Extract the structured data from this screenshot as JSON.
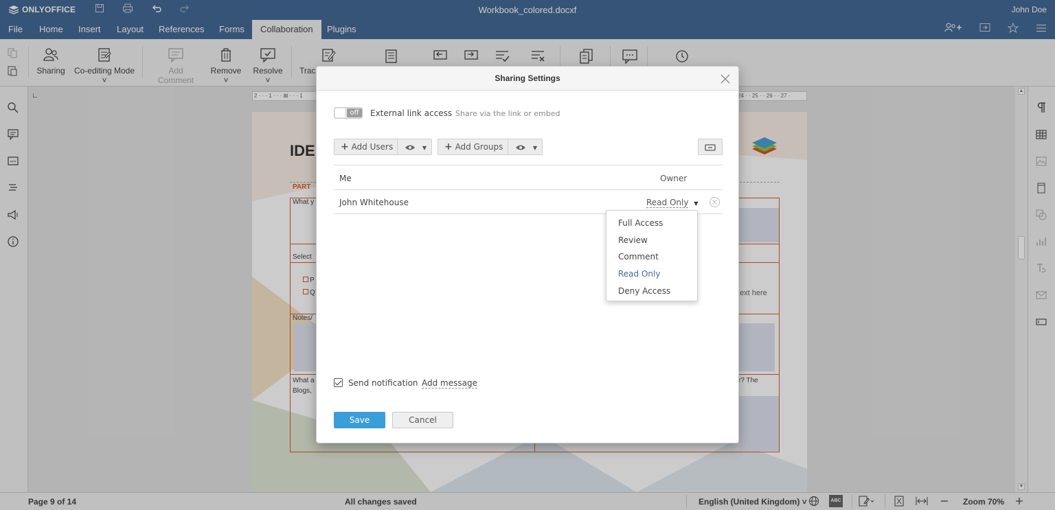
{
  "app": {
    "brand": "ONLYOFFICE",
    "doc_title": "Workbook_colored.docxf",
    "user": "John Doe"
  },
  "menu": {
    "tabs": [
      "File",
      "Home",
      "Insert",
      "Layout",
      "References",
      "Forms",
      "Collaboration",
      "Plugins"
    ],
    "active_tab": "Collaboration"
  },
  "toolbar": {
    "sharing": "Sharing",
    "coediting_mode": "Co-editing Mode",
    "add_comment": "Add Comment",
    "remove": "Remove",
    "resolve": "Resolve",
    "track_partial": "Trac"
  },
  "document": {
    "heading_partial": "IDE",
    "ruler_left": "2 · · · 1 · · · ⊠ · · · 1",
    "ruler_right": "24 · · 25 · · 26 · · 27 ·",
    "part_label": "PART",
    "cell_what": "What y",
    "cell_select": "Select",
    "option_p": "P",
    "option_q": "Q",
    "cell_text_here": "ext here",
    "cell_notes": "Notes/",
    "cell_what_a": "What a",
    "cell_blogs": "Blogs,",
    "cell_the": "r? The"
  },
  "dialog": {
    "title": "Sharing Settings",
    "external_toggle": "off",
    "external_label": "External link access",
    "external_hint": "Share via the link or embed",
    "add_users": "Add Users",
    "add_groups": "Add Groups",
    "rows": [
      {
        "name": "Me",
        "role": "Owner"
      },
      {
        "name": "John Whitehouse",
        "role": "Read Only"
      }
    ],
    "access_options": [
      "Full Access",
      "Review",
      "Comment",
      "Read Only",
      "Deny Access"
    ],
    "selected_access": "Read Only",
    "send_notification": "Send notification",
    "send_notification_checked": true,
    "add_message": "Add message",
    "save": "Save",
    "cancel": "Cancel"
  },
  "status": {
    "page": "Page 9 of 14",
    "saved": "All changes saved",
    "language": "English (United Kingdom)",
    "zoom": "Zoom 70%"
  },
  "colors": {
    "header": "#446995",
    "accent": "#3a9ed8",
    "table_border": "#d85a2a"
  }
}
